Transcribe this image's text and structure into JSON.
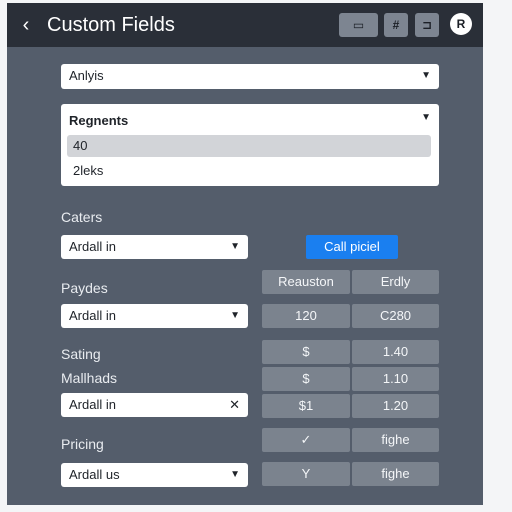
{
  "header": {
    "title": "Custom Fields",
    "back_icon": "‹",
    "buttons": [
      {
        "icon": "window-icon",
        "glyph": "▭"
      },
      {
        "icon": "hash-icon",
        "glyph": "#"
      },
      {
        "icon": "document-icon",
        "glyph": "⊐"
      }
    ],
    "avatar_glyph": "R"
  },
  "analysis_select": {
    "value": "Anlyis"
  },
  "dropdown": {
    "header": "Regnents",
    "options": [
      {
        "label": "40",
        "selected": true
      },
      {
        "label": "2leks",
        "selected": false
      }
    ]
  },
  "sections": {
    "caters": {
      "label": "Caters",
      "select_value": "Ardall in"
    },
    "paydes": {
      "label": "Paydes",
      "select_value": "Ardall in"
    },
    "sating": {
      "label": "Sating"
    },
    "mallhads": {
      "label": "Mallhads",
      "select_value": "Ardall in"
    },
    "pricing": {
      "label": "Pricing",
      "select_value": "Ardall us"
    }
  },
  "cta_button": {
    "label": "Call piciel"
  },
  "table": {
    "headers": [
      "Reauston",
      "Erdly"
    ],
    "rows": [
      [
        "120",
        "C280"
      ],
      [
        "$",
        "1.40"
      ],
      [
        "$",
        "1.10"
      ],
      [
        "$1",
        "1.20"
      ],
      [
        "✓",
        "fighe"
      ],
      [
        "Y",
        "fighe"
      ]
    ]
  },
  "colors": {
    "panel": "#545d6b",
    "topbar": "#2a2f38",
    "accent": "#1a7ff0",
    "table_cell": "#7b838e"
  }
}
